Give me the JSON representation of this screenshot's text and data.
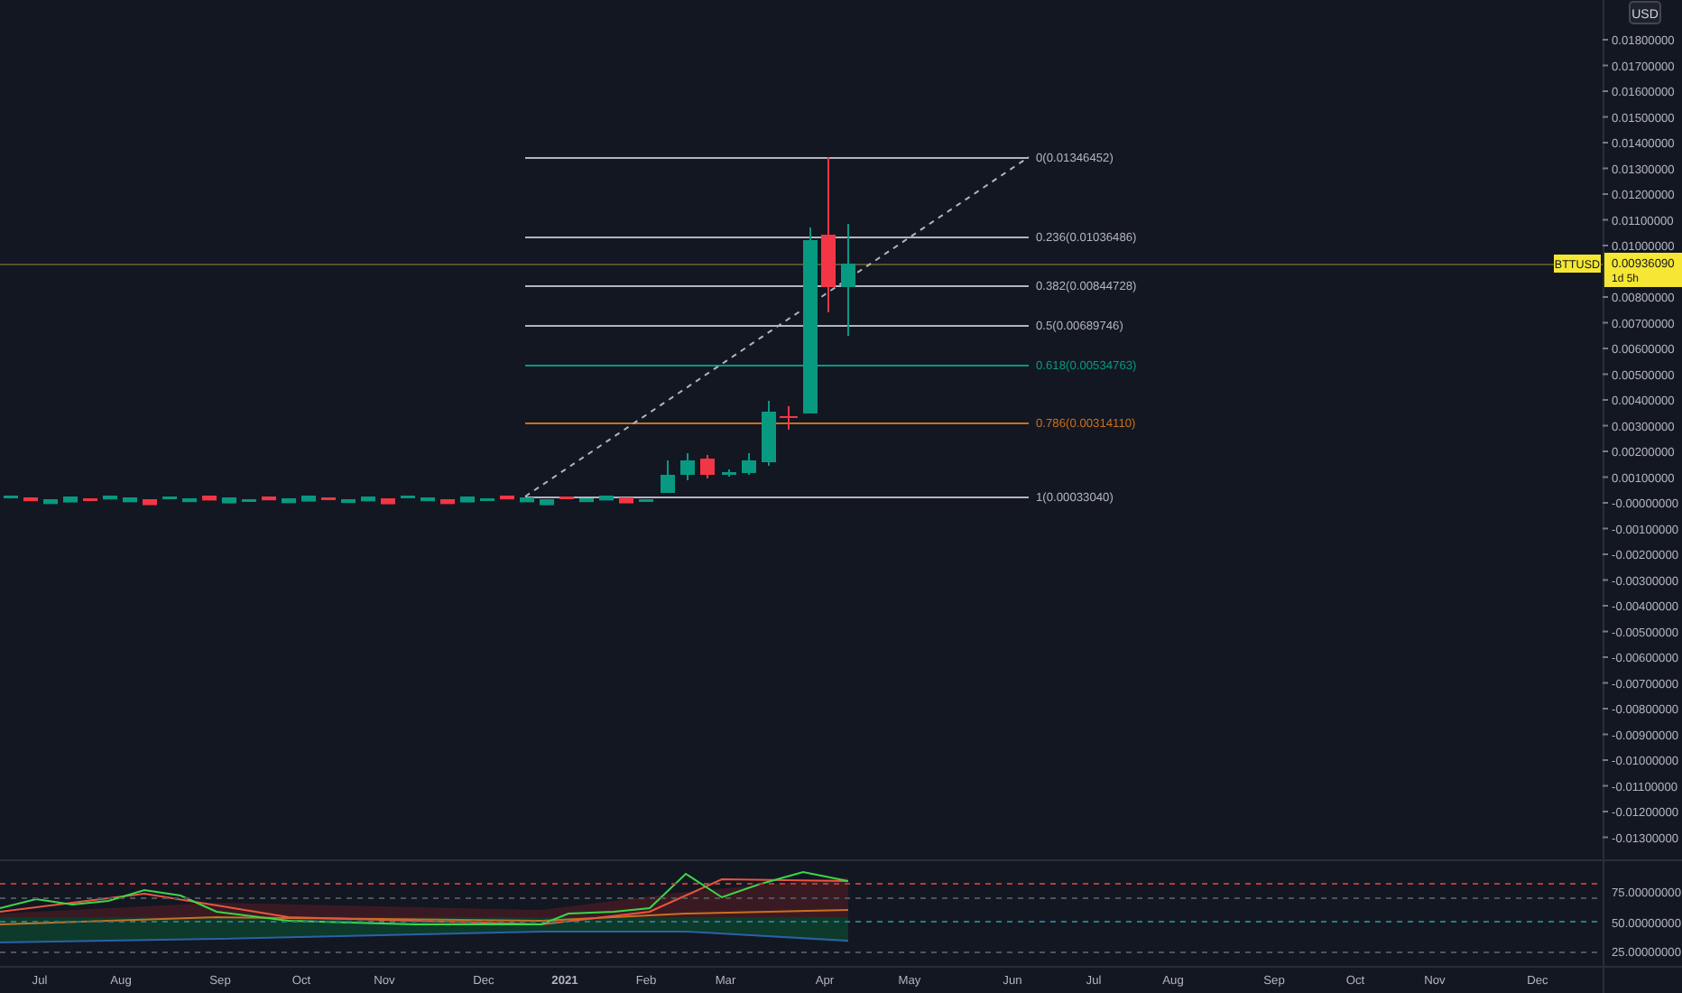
{
  "price_axis": {
    "currency": "USD",
    "labels": [
      "0.01800000",
      "0.01700000",
      "0.01600000",
      "0.01500000",
      "0.01400000",
      "0.01300000",
      "0.01200000",
      "0.01100000",
      "0.01000000",
      "0.00800000",
      "0.00700000",
      "0.00600000",
      "0.00500000",
      "0.00400000",
      "0.00300000",
      "0.00200000",
      "0.00100000",
      "-0.00000000",
      "-0.00100000",
      "-0.00200000",
      "-0.00300000",
      "-0.00400000",
      "-0.00500000",
      "-0.00600000",
      "-0.00700000",
      "-0.00800000",
      "-0.00900000",
      "-0.01000000",
      "-0.01100000",
      "-0.01200000",
      "-0.01300000"
    ]
  },
  "symbol": {
    "ticker": "BTTUSD",
    "price": "0.00936090",
    "countdown": "1d 5h"
  },
  "fib_levels": [
    {
      "label": "0(0.01346452)",
      "color": "#b2b5be"
    },
    {
      "label": "0.236(0.01036486)",
      "color": "#b2b5be"
    },
    {
      "label": "0.382(0.00844728)",
      "color": "#b2b5be"
    },
    {
      "label": "0.5(0.00689746)",
      "color": "#b2b5be"
    },
    {
      "label": "0.618(0.00534763)",
      "color": "#089981"
    },
    {
      "label": "0.786(0.00314110)",
      "color": "#c8701e"
    },
    {
      "label": "1(0.00033040)",
      "color": "#b2b5be"
    }
  ],
  "indicator_axis": [
    "75.00000000",
    "50.00000000",
    "25.00000000"
  ],
  "time_axis": [
    "Jul",
    "Aug",
    "Sep",
    "Oct",
    "Nov",
    "Dec",
    "2021",
    "Feb",
    "Mar",
    "Apr",
    "May",
    "Jun",
    "Jul",
    "Aug",
    "Sep",
    "Oct",
    "Nov",
    "Dec"
  ]
}
